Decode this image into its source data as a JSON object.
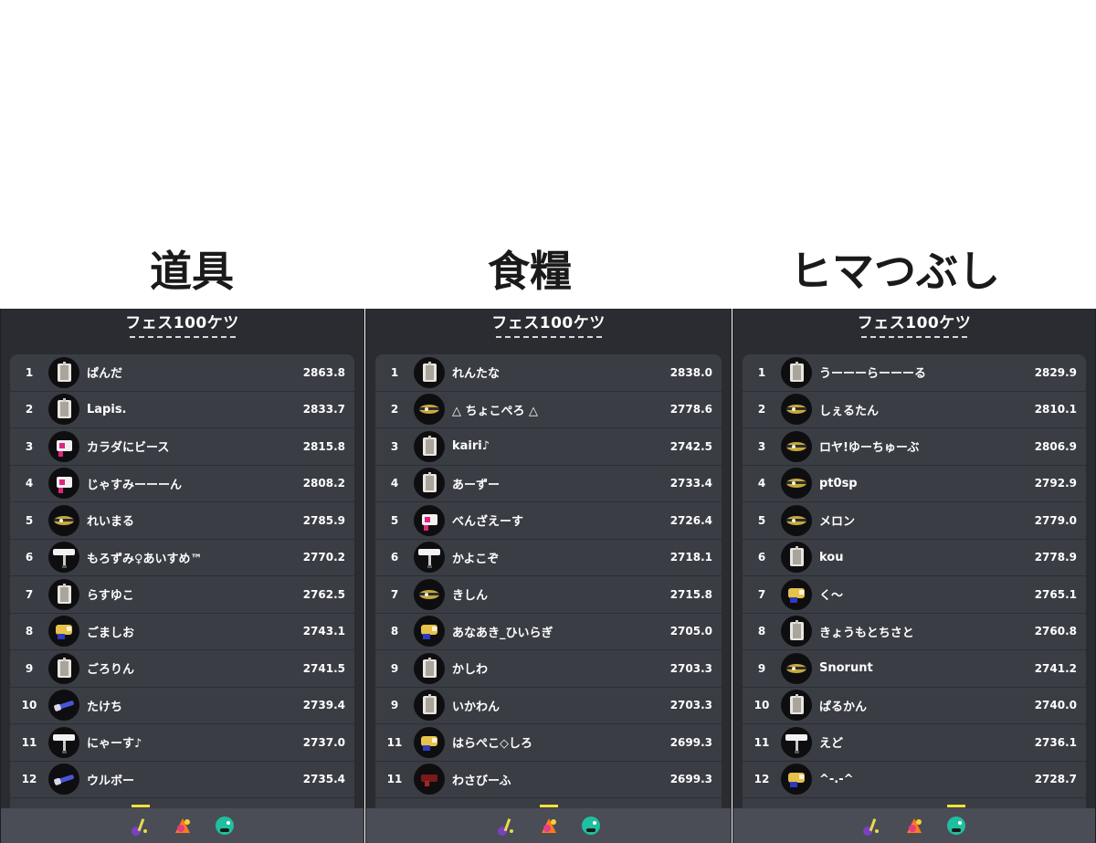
{
  "panels": [
    {
      "caption": "道具",
      "title": "フェス100ケツ",
      "active_tab": 0,
      "rows": [
        {
          "rank": "1",
          "name": "ぱんだ",
          "power": "2863.8",
          "weapon": "splatling"
        },
        {
          "rank": "2",
          "name": "Lapis.",
          "power": "2833.7",
          "weapon": "splatling"
        },
        {
          "rank": "3",
          "name": "カラダにビース",
          "power": "2815.8",
          "weapon": "pink-shooter"
        },
        {
          "rank": "4",
          "name": "じゃすみーーーん",
          "power": "2808.2",
          "weapon": "pink-shooter"
        },
        {
          "rank": "5",
          "name": "れいまる",
          "power": "2785.9",
          "weapon": "charger"
        },
        {
          "rank": "6",
          "name": "もろずみ♀あいすめ™",
          "power": "2770.2",
          "weapon": "roller"
        },
        {
          "rank": "7",
          "name": "らすゆこ",
          "power": "2762.5",
          "weapon": "splatling"
        },
        {
          "rank": "8",
          "name": "ごましお",
          "power": "2743.1",
          "weapon": "blaster"
        },
        {
          "rank": "9",
          "name": "ごろりん",
          "power": "2741.5",
          "weapon": "splatling"
        },
        {
          "rank": "10",
          "name": "たけち",
          "power": "2739.4",
          "weapon": "brush"
        },
        {
          "rank": "11",
          "name": "にゃーす♪",
          "power": "2737.0",
          "weapon": "roller"
        },
        {
          "rank": "12",
          "name": "ウルボー",
          "power": "2735.4",
          "weapon": "brush"
        }
      ]
    },
    {
      "caption": "食糧",
      "title": "フェス100ケツ",
      "active_tab": 1,
      "rows": [
        {
          "rank": "1",
          "name": "れんたな",
          "power": "2838.0",
          "weapon": "splatling"
        },
        {
          "rank": "2",
          "name": "△ ちょこぺろ △",
          "power": "2778.6",
          "weapon": "charger"
        },
        {
          "rank": "3",
          "name": "kairi♪",
          "power": "2742.5",
          "weapon": "splatling"
        },
        {
          "rank": "4",
          "name": "あーずー",
          "power": "2733.4",
          "weapon": "splatling"
        },
        {
          "rank": "5",
          "name": "べんざえーす",
          "power": "2726.4",
          "weapon": "pink-shooter"
        },
        {
          "rank": "6",
          "name": "かよこぞ",
          "power": "2718.1",
          "weapon": "roller"
        },
        {
          "rank": "7",
          "name": "きしん",
          "power": "2715.8",
          "weapon": "charger"
        },
        {
          "rank": "8",
          "name": "あなあき_ひいらぎ",
          "power": "2705.0",
          "weapon": "blaster"
        },
        {
          "rank": "9",
          "name": "かしわ",
          "power": "2703.3",
          "weapon": "splatling"
        },
        {
          "rank": "9",
          "name": "いかわん",
          "power": "2703.3",
          "weapon": "splatling"
        },
        {
          "rank": "11",
          "name": "はらぺこ◇しろ",
          "power": "2699.3",
          "weapon": "blaster"
        },
        {
          "rank": "11",
          "name": "わさびーふ",
          "power": "2699.3",
          "weapon": "red-shooter"
        }
      ]
    },
    {
      "caption": "ヒマつぶし",
      "title": "フェス100ケツ",
      "active_tab": 2,
      "rows": [
        {
          "rank": "1",
          "name": "うーーーらーーーる",
          "power": "2829.9",
          "weapon": "splatling"
        },
        {
          "rank": "2",
          "name": "しぇるたん",
          "power": "2810.1",
          "weapon": "charger"
        },
        {
          "rank": "3",
          "name": "ロヤ!ゆーちゅーぶ",
          "power": "2806.9",
          "weapon": "charger"
        },
        {
          "rank": "4",
          "name": "pt0sp",
          "power": "2792.9",
          "weapon": "charger"
        },
        {
          "rank": "5",
          "name": "メロン",
          "power": "2779.0",
          "weapon": "charger"
        },
        {
          "rank": "6",
          "name": "kou",
          "power": "2778.9",
          "weapon": "splatling"
        },
        {
          "rank": "7",
          "name": "く〜",
          "power": "2765.1",
          "weapon": "blaster"
        },
        {
          "rank": "8",
          "name": "きょうもとちさと",
          "power": "2760.8",
          "weapon": "splatling"
        },
        {
          "rank": "9",
          "name": "Snorunt",
          "power": "2741.2",
          "weapon": "charger"
        },
        {
          "rank": "10",
          "name": "ぱるかん",
          "power": "2740.0",
          "weapon": "splatling"
        },
        {
          "rank": "11",
          "name": "えど",
          "power": "2736.1",
          "weapon": "roller"
        },
        {
          "rank": "12",
          "name": "^-.-^",
          "power": "2728.7",
          "weapon": "blaster"
        }
      ]
    }
  ],
  "tabs": [
    {
      "icon": "tools-icon"
    },
    {
      "icon": "food-icon"
    },
    {
      "icon": "fun-icon"
    }
  ],
  "colors": {
    "panel_bg": "#2b2c31",
    "list_bg": "#3a3d44",
    "tabbar_bg": "#4a4d56",
    "active_indicator": "#f5e23a"
  }
}
